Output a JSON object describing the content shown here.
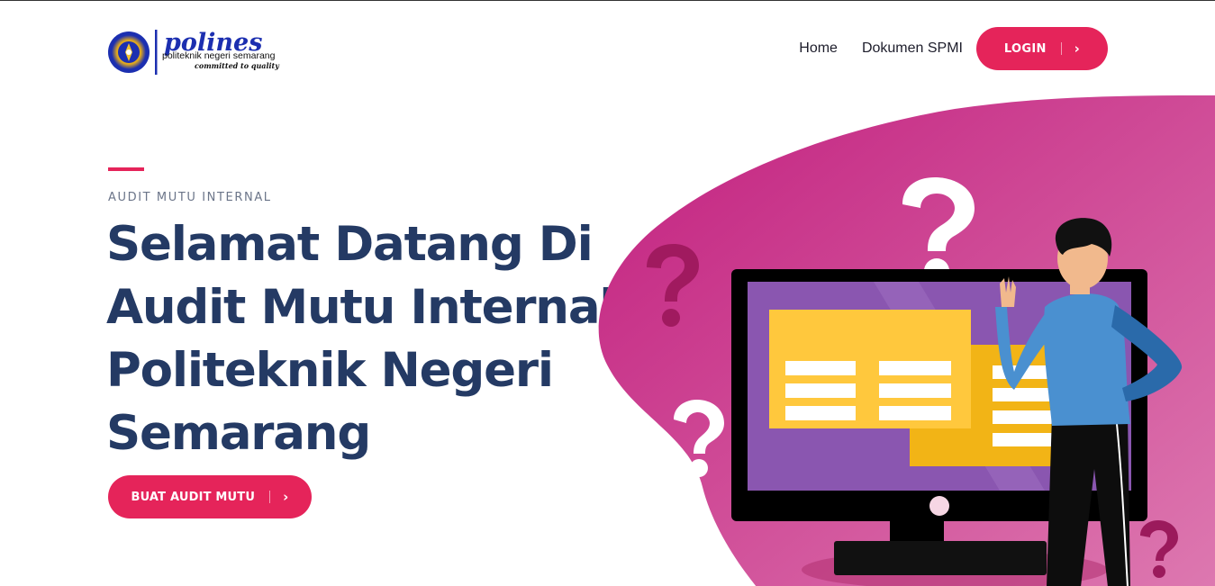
{
  "header": {
    "logo": {
      "name": "polines",
      "subtitle": "politeknik negeri semarang",
      "tagline": "committed to quality"
    },
    "nav": [
      {
        "label": "Home"
      },
      {
        "label": "Dokumen SPMI"
      }
    ],
    "login_label": "LOGIN",
    "login_chevron": "›"
  },
  "hero": {
    "eyebrow": "AUDIT MUTU INTERNAL",
    "title_lines": [
      "Selamat Datang Di",
      "Audit Mutu Internal",
      "Politeknik Negeri",
      "Semarang"
    ],
    "cta_label": "BUAT AUDIT MUTU",
    "cta_chevron": "›"
  },
  "colors": {
    "accent": "#e5245a",
    "heading": "#243a64",
    "blob_start": "#c21f7e",
    "blob_end": "#d86aa8",
    "screen": "#8a56b0",
    "panel": "#ffc83d"
  },
  "icons": [
    "emblem-icon",
    "chevron-right-icon",
    "question-mark-icon",
    "monitor-icon",
    "person-figure"
  ]
}
